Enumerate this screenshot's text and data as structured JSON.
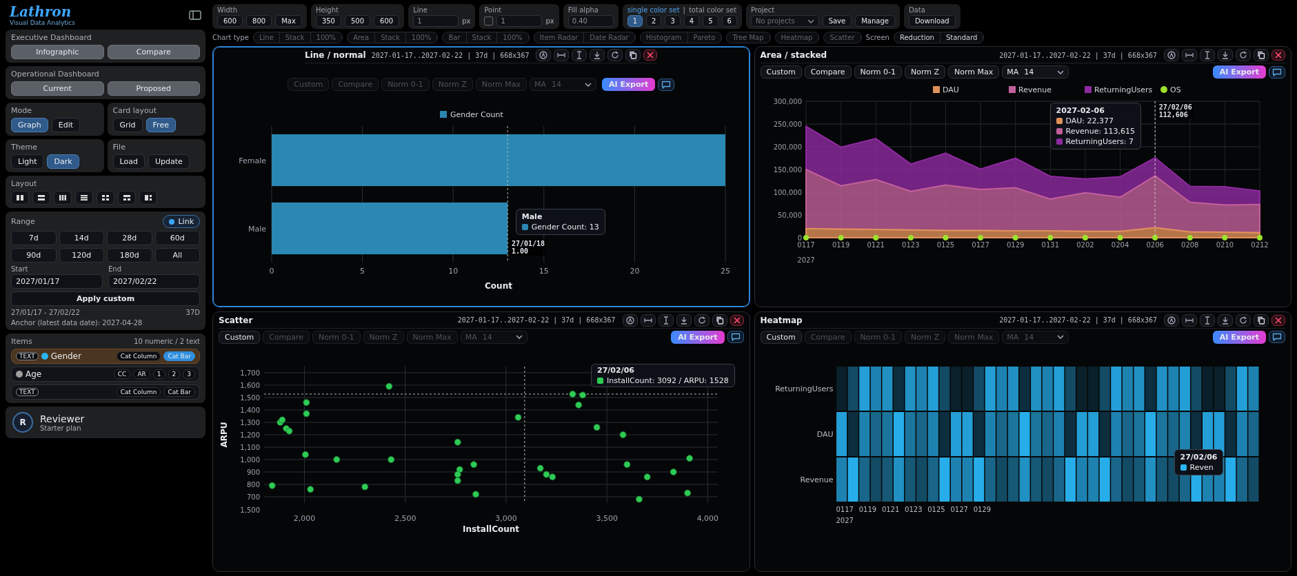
{
  "brand": {
    "logo": "Lathron",
    "tagline": "Visual Data Analytics"
  },
  "sidebar": {
    "executive": {
      "title": "Executive Dashboard",
      "buttons": [
        "Infographic",
        "Compare"
      ]
    },
    "operational": {
      "title": "Operational Dashboard",
      "buttons": [
        "Current",
        "Proposed"
      ]
    },
    "mode": {
      "title": "Mode",
      "options": [
        {
          "label": "Graph",
          "selected": true
        },
        {
          "label": "Edit",
          "selected": false
        }
      ]
    },
    "card_layout": {
      "title": "Card layout",
      "options": [
        {
          "label": "Grid",
          "selected": false
        },
        {
          "label": "Free",
          "selected": true
        }
      ]
    },
    "theme": {
      "title": "Theme",
      "options": [
        {
          "label": "Light",
          "selected": false
        },
        {
          "label": "Dark",
          "selected": true
        }
      ]
    },
    "file": {
      "title": "File",
      "buttons": [
        "Load",
        "Update"
      ]
    },
    "layout": {
      "title": "Layout"
    },
    "range": {
      "title": "Range",
      "presets": [
        "7d",
        "14d",
        "28d",
        "60d",
        "90d",
        "120d",
        "180d",
        "All"
      ],
      "link": {
        "label": "Link",
        "on": true
      },
      "start": {
        "label": "Start",
        "value": "2027/01/17"
      },
      "end": {
        "label": "End",
        "value": "2027/02/22"
      },
      "apply": "Apply custom",
      "summary": "27/01/17 - 27/02/22",
      "days": "37D",
      "anchor": "Anchor (latest data date): 2027-04-28"
    },
    "items": {
      "title": "Items",
      "count": "10 numeric / 2 text",
      "rows": [
        {
          "badge": "TEXT",
          "name": "Gender",
          "color": "#29b6f6",
          "selected": true,
          "chips": [
            {
              "label": "Cat Column",
              "selected": false
            },
            {
              "label": "Cat Bar",
              "selected": true
            }
          ]
        },
        {
          "name": "Age",
          "color": "#9e9e9e",
          "selected": false,
          "chips": [
            {
              "label": "CC",
              "selected": false
            },
            {
              "label": "AR",
              "selected": false
            },
            {
              "label": "1",
              "selected": false
            },
            {
              "label": "2",
              "selected": false
            },
            {
              "label": "3",
              "selected": false
            }
          ]
        },
        {
          "badge": "TEXT",
          "selected": false,
          "chips": [
            {
              "label": "Cat Column",
              "selected": false
            },
            {
              "label": "Cat Bar",
              "selected": false
            }
          ]
        }
      ]
    },
    "user": {
      "initial": "R",
      "name": "Reviewer",
      "plan": "Starter plan"
    }
  },
  "toolbar": {
    "width": {
      "label": "Width",
      "options": [
        "600",
        "800",
        "Max"
      ]
    },
    "height": {
      "label": "Height",
      "options": [
        "350",
        "500",
        "600"
      ]
    },
    "line": {
      "label": "Line",
      "value": "1",
      "unit": "px"
    },
    "point": {
      "label": "Point",
      "checked": false,
      "value": "1",
      "unit": "px"
    },
    "fill_alpha": {
      "label": "Fill alpha",
      "value": "0.40"
    },
    "color_set": {
      "single": "single color set",
      "separator": "|",
      "total": "total color set",
      "options": [
        {
          "label": "1",
          "selected": true
        },
        {
          "label": "2",
          "selected": false
        },
        {
          "label": "3",
          "selected": false
        },
        {
          "label": "4",
          "selected": false
        },
        {
          "label": "5",
          "selected": false
        },
        {
          "label": "6",
          "selected": false
        }
      ]
    },
    "project": {
      "label": "Project",
      "placeholder": "No projects",
      "buttons": [
        "Save",
        "Manage"
      ]
    },
    "data": {
      "label": "Data",
      "buttons": [
        "Download"
      ]
    }
  },
  "chart_types": {
    "label": "Chart type",
    "groups": [
      [
        "Line",
        "Stack",
        "100%"
      ],
      [
        "Area",
        "Stack",
        "100%"
      ],
      [
        "Bar",
        "Stack",
        "100%"
      ],
      [
        "Item Radar",
        "Date Radar"
      ],
      [
        "Histogram",
        "Pareto"
      ],
      [
        "Tree Map"
      ],
      [
        "Heatmap"
      ],
      [
        "Scatter"
      ]
    ],
    "screen": {
      "label": "Screen",
      "options": [
        "Reduction",
        "Standard"
      ]
    }
  },
  "cards": [
    {
      "kind": "bar",
      "title": "Line / normal",
      "selected": true,
      "info": "2027-01-17..2027-02-22 | 37d | 668x367",
      "ai_export": "AI Export",
      "controls": [
        {
          "label": "Custom",
          "disabled": true
        },
        {
          "label": "Compare",
          "disabled": true
        },
        {
          "label": "Norm 0-1",
          "disabled": true
        },
        {
          "label": "Norm Z",
          "disabled": true
        },
        {
          "label": "Norm Max",
          "disabled": true
        }
      ],
      "ma": {
        "label": "MA",
        "value": "14",
        "disabled": true
      },
      "chart_data": {
        "type": "bar",
        "orientation": "horizontal",
        "grid": true,
        "legend": "top",
        "categories": [
          "Female",
          "Male"
        ],
        "series": [
          {
            "name": "Gender Count",
            "color": "#2a88b3",
            "values": [
              25,
              13
            ]
          }
        ],
        "xlabel": "Count",
        "xlim": [
          0,
          25
        ],
        "xticks": [
          0,
          5,
          10,
          15,
          20,
          25
        ],
        "ref_lines": [
          {
            "axis": "x",
            "value": 13
          }
        ]
      },
      "tooltip": {
        "title": "Male",
        "lines": [
          "Gender Count: 13"
        ]
      },
      "crosshair": [
        "27/01/18",
        "1.00"
      ]
    },
    {
      "kind": "area",
      "title": "Area / stacked",
      "selected": false,
      "info": "2027-01-17..2027-02-22 | 37d | 668x367",
      "ai_export": "AI Export",
      "controls": [
        {
          "label": "Custom",
          "disabled": false
        },
        {
          "label": "Compare",
          "disabled": false
        },
        {
          "label": "Norm 0-1",
          "disabled": false
        },
        {
          "label": "Norm Z",
          "disabled": false
        },
        {
          "label": "Norm Max",
          "disabled": false
        }
      ],
      "ma": {
        "label": "MA",
        "value": "14",
        "disabled": false
      },
      "chart_data": {
        "type": "area",
        "stacked": true,
        "grid": true,
        "legend": "top",
        "ref_lines": [
          {
            "axis": "x",
            "value": "0206"
          }
        ],
        "xlabel": "2027",
        "categories": [
          "0117",
          "0119",
          "0121",
          "0123",
          "0125",
          "0127",
          "0129",
          "0131",
          "0202",
          "0204",
          "0206",
          "0208",
          "0210",
          "0212"
        ],
        "series": [
          {
            "name": "DAU",
            "color": "#e0915a",
            "values": [
              20000,
              19000,
              18000,
              17000,
              16000,
              16000,
              15000,
              15000,
              14000,
              14000,
              22000,
              13000,
              12000,
              11000
            ]
          },
          {
            "name": "Revenue",
            "color": "#c2609a",
            "values": [
              130000,
              95000,
              110000,
              85000,
              100000,
              90000,
              95000,
              70000,
              85000,
              75000,
              114000,
              65000,
              60000,
              62000
            ]
          },
          {
            "name": "ReturningUsers",
            "color": "#8e2aa0",
            "values": [
              95000,
              85000,
              90000,
              60000,
              70000,
              45000,
              65000,
              50000,
              30000,
              45000,
              40000,
              35000,
              40000,
              30000
            ]
          }
        ],
        "ylim": [
          0,
          300000
        ],
        "yticks": [
          {
            "value": 0,
            "label": "0"
          },
          {
            "value": 50000,
            "label": "50,000"
          },
          {
            "value": 100000,
            "label": "100,000"
          },
          {
            "value": 150000,
            "label": "150,000"
          },
          {
            "value": 200000,
            "label": "200,000"
          },
          {
            "value": 250000,
            "label": "250,000"
          },
          {
            "value": 300000,
            "label": "300,000"
          }
        ]
      },
      "markers": {
        "name": "OS",
        "color": "#9be22d"
      },
      "tooltip": {
        "title": "2027-02-06",
        "lines": [
          "DAU: 22,377",
          "Revenue: 113,615",
          "ReturningUsers: 7"
        ]
      },
      "crosshair": [
        "27/02/06",
        "112,606"
      ]
    },
    {
      "kind": "scatter",
      "title": "Scatter",
      "selected": false,
      "info": "2027-01-17..2027-02-22 | 37d | 668x367",
      "ai_export": "AI Export",
      "controls": [
        {
          "label": "Custom",
          "disabled": false
        },
        {
          "label": "Compare",
          "disabled": true
        },
        {
          "label": "Norm 0-1",
          "disabled": true
        },
        {
          "label": "Norm Z",
          "disabled": true
        },
        {
          "label": "Norm Max",
          "disabled": true
        }
      ],
      "ma": {
        "label": "MA",
        "value": "14",
        "disabled": true
      },
      "chart_data": {
        "type": "scatter",
        "grid": true,
        "ref_lines": [
          {
            "axis": "x",
            "value": 3092
          },
          {
            "axis": "y",
            "value": 1528
          }
        ],
        "xlabel": "InstallCount",
        "ylabel": "ARPU",
        "xlim": [
          1800,
          4050
        ],
        "ylim": [
          650,
          1750
        ],
        "xticks": [
          {
            "value": 2000,
            "label": "2,000"
          },
          {
            "value": 2500,
            "label": "2,500"
          },
          {
            "value": 3000,
            "label": "3,000"
          },
          {
            "value": 3500,
            "label": "3,500"
          },
          {
            "value": 4000,
            "label": "4,000"
          }
        ],
        "yticks": [
          {
            "value": 700,
            "label": "700"
          },
          {
            "value": 800,
            "label": "800"
          },
          {
            "value": 900,
            "label": "900"
          },
          {
            "value": 1000,
            "label": "1,000"
          },
          {
            "value": 1100,
            "label": "1,100"
          },
          {
            "value": 1200,
            "label": "1,200"
          },
          {
            "value": 1300,
            "label": "1,300"
          },
          {
            "value": 1400,
            "label": "1,400"
          },
          {
            "value": 1500,
            "label": "1,500"
          },
          {
            "value": 1600,
            "label": "1,600"
          },
          {
            "value": 1700,
            "label": "1,700"
          }
        ],
        "x": [
          1880,
          1890,
          1910,
          1925,
          2010,
          2010,
          2005,
          1840,
          2160,
          2030,
          2420,
          2430,
          2300,
          2760,
          2770,
          2760,
          2760,
          2840,
          2850,
          3060,
          3170,
          3200,
          3230,
          3330,
          3380,
          3360,
          3450,
          3580,
          3600,
          3700,
          3830,
          3900,
          3910,
          3660
        ],
        "series": [
          {
            "color": "#2ecc55",
            "values": [
              1300,
              1320,
              1250,
              1230,
              1460,
              1370,
              1040,
              790,
              1000,
              760,
              1590,
              1000,
              780,
              1140,
              920,
              880,
              830,
              960,
              720,
              1340,
              930,
              880,
              860,
              1528,
              1520,
              1440,
              1260,
              1200,
              960,
              860,
              900,
              730,
              1010,
              680
            ]
          }
        ],
        "annotations": [
          {
            "text": "1,500"
          }
        ]
      },
      "tooltip": {
        "title": "27/02/06",
        "lines": [
          "InstallCount: 3092 / ARPU: 1528"
        ]
      }
    },
    {
      "kind": "heatmap",
      "title": "Heatmap",
      "selected": false,
      "info": "2027-01-17..2027-02-22 | 37d | 668x367",
      "ai_export": "AI Export",
      "controls": [
        {
          "label": "Custom",
          "disabled": false
        },
        {
          "label": "Compare",
          "disabled": true
        },
        {
          "label": "Norm 0-1",
          "disabled": true
        },
        {
          "label": "Norm Z",
          "disabled": true
        },
        {
          "label": "Norm Max",
          "disabled": true
        }
      ],
      "ma": {
        "label": "MA",
        "value": "14",
        "disabled": true
      },
      "heatmap": {
        "rows": [
          "ReturningUsers",
          "DAU",
          "Revenue"
        ],
        "xlabels": [
          "0117",
          "0119",
          "0121",
          "0123",
          "0125",
          "0127",
          "0129"
        ],
        "year": "2027"
      },
      "tooltip": {
        "title": "27/02/06",
        "lines": [
          "Reven"
        ]
      }
    }
  ]
}
